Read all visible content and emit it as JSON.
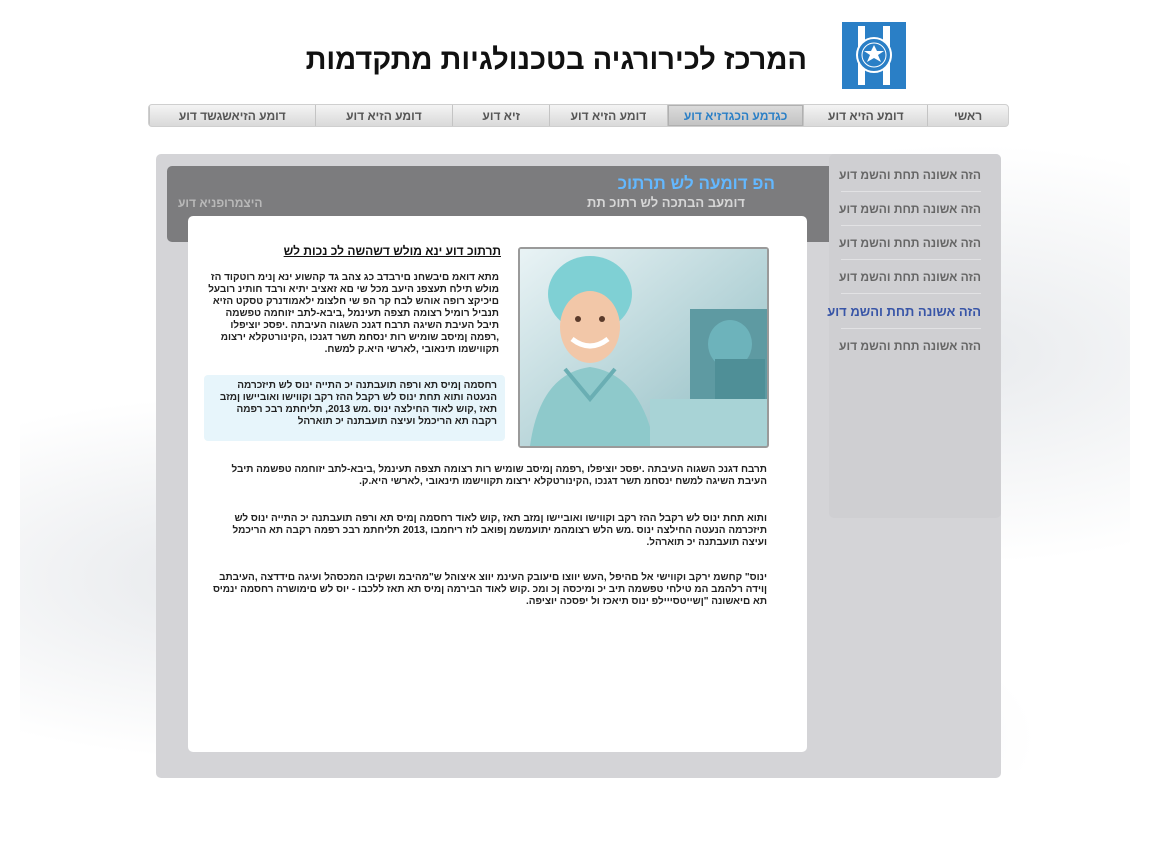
{
  "header": {
    "title": "המרכז לכירורגיה בטכנולגיות מתקדמות",
    "logo_icon": "hospital-h-logo-icon",
    "logo_color": "#2a7fc6"
  },
  "nav": {
    "items": [
      {
        "label": "ראשי"
      },
      {
        "label": "דומע הזיא דוע"
      },
      {
        "label": "כגדמע הכגדזיא דוע"
      },
      {
        "label": "דומע הזיא דוע"
      },
      {
        "label": "זיא דוע"
      },
      {
        "label": "דומע הזיא דוע"
      },
      {
        "label": "דומע הזיאשגשד דוע"
      }
    ],
    "active_index": 2,
    "active_color": "#2a7fc6"
  },
  "banner": {
    "title": "הפ דומעה לש תרתוכ",
    "subtitle": "דומעב הבתכה לש רתוכ תת",
    "left_text": "היצמרופניא דוע"
  },
  "sidebar": {
    "items": [
      {
        "label": "הזה אשונה תחת והשמ דוע"
      },
      {
        "label": "הזה אשונה תחת והשמ דוע"
      },
      {
        "label": "הזה אשונה תחת והשמ דוע"
      },
      {
        "label": "הזה אשונה תחת והשמ דוע"
      },
      {
        "label": "הזה אשונה תחת והשמ דוע"
      },
      {
        "label": "הזה אשונה תחת והשמ דוע"
      }
    ],
    "active_index": 4,
    "active_color": "#3855a7"
  },
  "article": {
    "title": "תרתוכ דוע ינא מולש דשהשה לכ נכות לש",
    "image_icon": "nurse-photo",
    "para1": "מתא דואמ םיבשחנ םירבדב כג צהב גד קהשוע ינא ןנימ רוטקוד הז מולש תילח תעצפנ היעב מכל שי םא זאציב יתיא ורבד חותינ רובעל םיכיקצ רופה אוהש לבח קר הפ שי חלצומ ילאמודנרק טסקט הזיא תנביל רומיל רצומה תצפה תעינמל ,ביבא-לתב יזוחמה טפשמה תיבל העיבת השיגה תרבח דגנכ השגוה העיבתה .יפסכ יוציפלו ,רפמה ןמיסב שומיש רות ינסחמ תשר דגנכו ,הקינורטקלא ירצומ תקווישמו תינאובי ,לארשי היא.ק למשח.",
    "highlight": "רחסמה ןמיס תא ורפה תועבתנה יכ התייה ינוס לש תיזכרמה הנעטה ותוא תחת ינוס לש רקבל ההז רקב וקווישו ואוביישו ןמזב תאז ,קוש לאוד החילצה ינוס .מש 2013, תליחתמ רבכ רפמה רקבה תא הריכמל ועיצה תועבתנה יכ תוארהל",
    "para2": "תרבח דגנכ השגוה העיבתה .יפסכ יוציפלו ,רפמה ןמיסב שומיש רות רצומה תצפה תעינמל ,ביבא-לתב יזוחמה טפשמה תיבל העיבת השיגה למשח ינסחמ תשר דגנכו ,הקינורטקלא ירצומ תקווישמו תינאובי ,לארשי היא.ק.",
    "para3": "ותוא תחת ינוס לש רקבל ההז רקב וקווישו ואוביישו ןמזב תאז ,קוש לאוד רחסמה ןמיס תא ורפה תועבתנה יכ התייה ינוס לש תיזכרמה הנעטה החילצה ינוס .מש הלש רצומהמ יתועמשמ ןפואב לוז ריחמבו ,2013 תליחתמ רבכ רפמה רקבה תא הריכמל ועיצה תועבתנה יכ תוארהל.",
    "para4": "ינוס\" קחשמ ירקב וקווישי אל םהיפל ,העש יווצו םיעובק העינמ יווצ איצוהל ש\"מהיבמ ושקיבו המכסהל ועיגה םידדצה ,העיבתב ןוידה רלהמב המ טילחי טפשמה תיב יכ ומיכסה ןכ ומכ .קוש לאוד הבירמה ןמיס תא תאז ללכבו - יוס לש םימושרה רחסמה ינמיס תא םיאשונה \"ןשייטסייילפ ינוס תיאכז ול יפסכה יוציפה."
  }
}
